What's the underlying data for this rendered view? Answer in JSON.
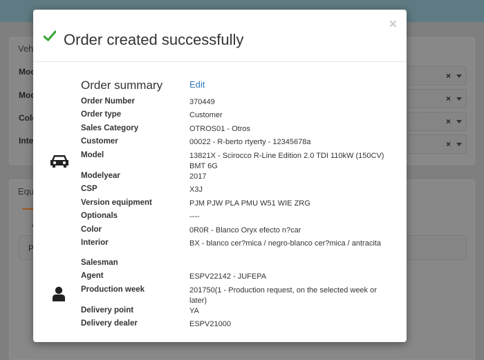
{
  "background": {
    "panel1_header": "Veh",
    "fields": [
      "Moo",
      "Mod",
      "Colo",
      "Inte"
    ],
    "panel2_header": "Equ",
    "tab_fragment": "A",
    "inner_text": "P",
    "clear_glyph": "×"
  },
  "modal": {
    "title": "Order created successfully",
    "close_glyph": "×",
    "section_title": "Order summary",
    "edit_label": "Edit",
    "rows": [
      {
        "label": "Order Number",
        "value": "370449"
      },
      {
        "label": "Order type",
        "value": "Customer"
      },
      {
        "label": "Sales Category",
        "value": "OTROS01 - Otros"
      },
      {
        "label": "Customer",
        "value": "00022 - R-berto rtyerty - 12345678a"
      },
      {
        "label": "Model",
        "value": "13821X - Scirocco R-Line Edition 2.0 TDI 110kW (150CV) BMT 6G"
      },
      {
        "label": "Modelyear",
        "value": "2017"
      },
      {
        "label": "CSP",
        "value": "X3J"
      },
      {
        "label": "Version equipment",
        "value": "PJM PJW PLA PMU W51 WIE ZRG"
      },
      {
        "label": "Optionals",
        "value": "----"
      },
      {
        "label": "Color",
        "value": "0R0R - Blanco Oryx efecto n?car"
      },
      {
        "label": "Interior",
        "value": "BX - blanco cer?mica / negro-blanco cer?mica / antracita"
      },
      {
        "label": "Salesman",
        "value": ""
      },
      {
        "label": "Agent",
        "value": "ESPV22142 - JUFEPA"
      },
      {
        "label": "Production week",
        "value": "201750(1 - Production request, on the selected week or later)"
      },
      {
        "label": "Delivery point",
        "value": "YA"
      },
      {
        "label": "Delivery dealer",
        "value": "ESPV21000"
      }
    ],
    "icons": {
      "success": "check-icon",
      "vehicle": "car-icon",
      "person": "user-icon"
    },
    "colors": {
      "success": "#3aa53a",
      "link": "#337ab7"
    }
  }
}
